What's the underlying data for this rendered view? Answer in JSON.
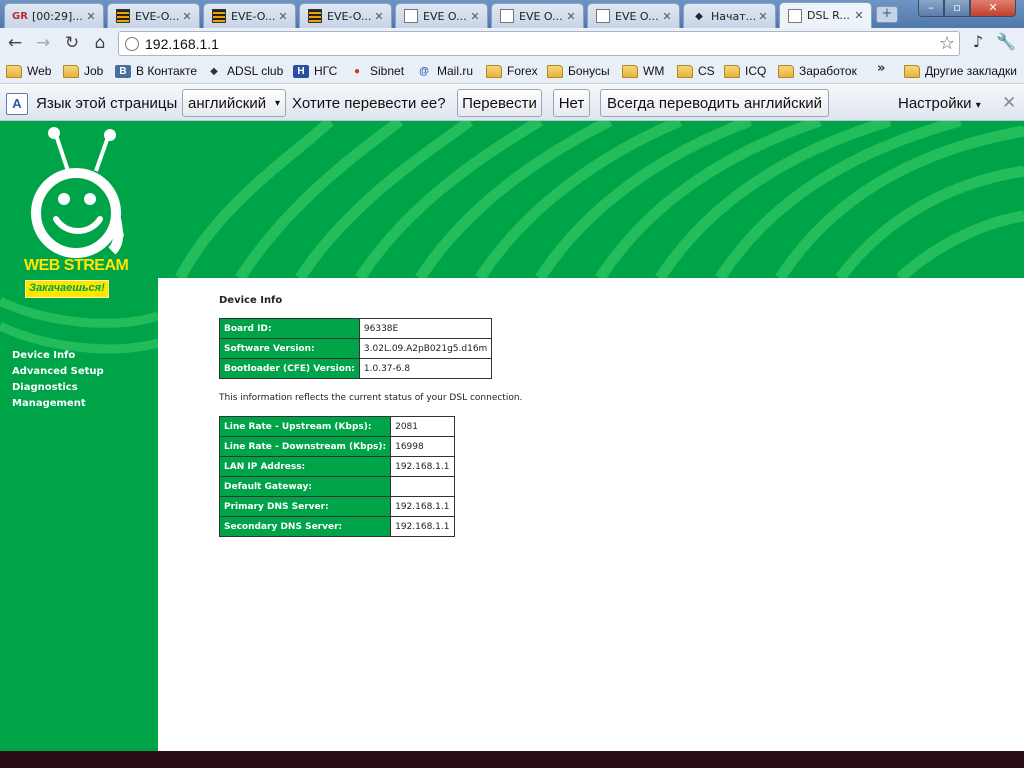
{
  "tabs": [
    {
      "title": "[00:29]...",
      "icon": "gr-icon"
    },
    {
      "title": "EVE-O...",
      "icon": "eve-icon"
    },
    {
      "title": "EVE-O...",
      "icon": "eve-icon"
    },
    {
      "title": "EVE-O...",
      "icon": "eve-icon"
    },
    {
      "title": "EVE O...",
      "icon": "doc-icon"
    },
    {
      "title": "EVE O...",
      "icon": "doc-icon"
    },
    {
      "title": "EVE O...",
      "icon": "doc-icon"
    },
    {
      "title": "Начат...",
      "icon": "adsl-icon"
    },
    {
      "title": "DSL R...",
      "icon": "doc-icon",
      "active": true
    }
  ],
  "toolbar": {
    "url": "192.168.1.1"
  },
  "bookmarks": {
    "items": [
      {
        "label": "Web",
        "icon": "folder-icon"
      },
      {
        "label": "Job",
        "icon": "folder-icon"
      },
      {
        "label": "В Контакте",
        "icon": "vk-icon"
      },
      {
        "label": "ADSL club",
        "icon": "adsl-icon"
      },
      {
        "label": "НГС",
        "icon": "ngs-icon"
      },
      {
        "label": "Sibnet",
        "icon": "sibnet-icon"
      },
      {
        "label": "Mail.ru",
        "icon": "mail-icon"
      },
      {
        "label": "Forex",
        "icon": "folder-icon"
      },
      {
        "label": "Бонусы",
        "icon": "folder-icon"
      },
      {
        "label": "WM",
        "icon": "folder-icon"
      },
      {
        "label": "CS",
        "icon": "folder-icon"
      },
      {
        "label": "ICQ",
        "icon": "folder-icon"
      },
      {
        "label": "Заработок",
        "icon": "folder-icon"
      }
    ],
    "chevron": "»",
    "other": "Другие закладки"
  },
  "translate": {
    "prefix": "Язык этой страницы",
    "language": "английский",
    "question": "Хотите перевести ее?",
    "translate_button": "Перевести",
    "no_button": "Нет",
    "always_button": "Всегда переводить английский",
    "options": "Настройки",
    "close": "✕"
  },
  "router": {
    "brand": "WEB STREAM",
    "slogan": "Закачаешься!",
    "nav": [
      "Device Info",
      "Advanced Setup",
      "Diagnostics",
      "Management"
    ],
    "section_title": "Device Info",
    "device_table": [
      {
        "label": "Board ID:",
        "value": "96338E"
      },
      {
        "label": "Software Version:",
        "value": "3.02L.09.A2pB021g5.d16m"
      },
      {
        "label": "Bootloader (CFE) Version:",
        "value": "1.0.37-6.8"
      }
    ],
    "status_note": "This information reflects the current status of your DSL connection.",
    "status_table": [
      {
        "label": "Line Rate - Upstream (Kbps):",
        "value": "2081"
      },
      {
        "label": "Line Rate - Downstream (Kbps):",
        "value": "16998"
      },
      {
        "label": "LAN IP Address:",
        "value": "192.168.1.1"
      },
      {
        "label": "Default Gateway:",
        "value": ""
      },
      {
        "label": "Primary DNS Server:",
        "value": "192.168.1.1"
      },
      {
        "label": "Secondary DNS Server:",
        "value": "192.168.1.1"
      }
    ]
  },
  "colors": {
    "router_green": "#00a448",
    "brand_yellow": "#ffe600"
  }
}
